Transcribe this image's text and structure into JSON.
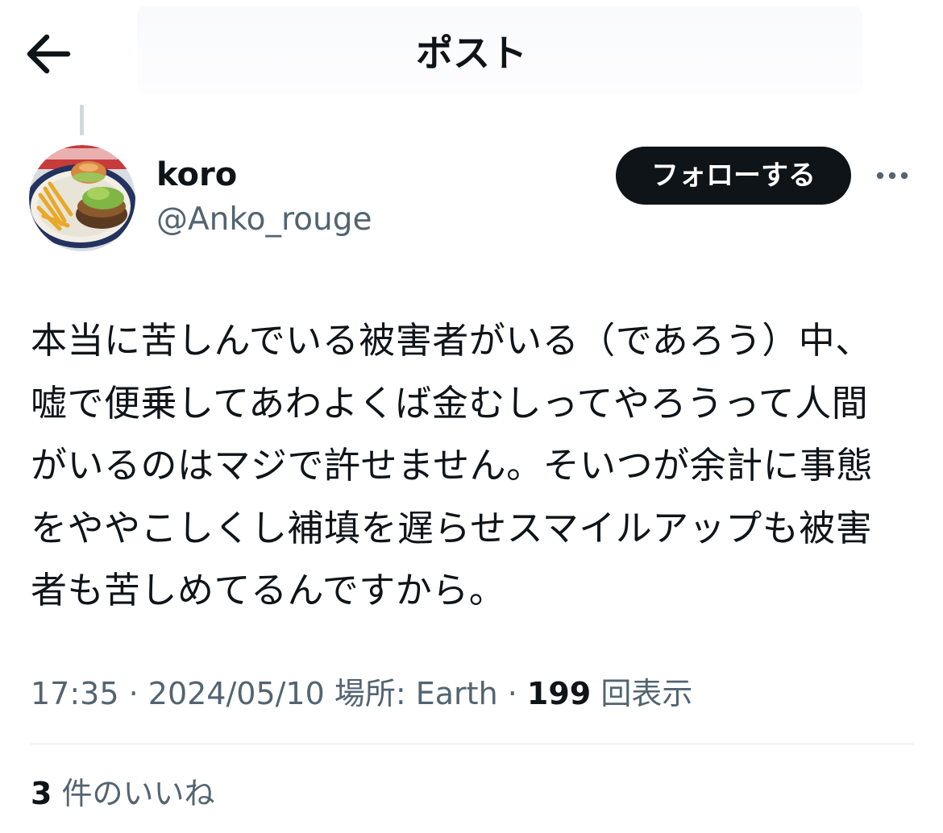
{
  "header": {
    "title": "ポスト",
    "back_icon": "arrow-left-icon"
  },
  "author": {
    "display_name": "koro",
    "handle": "@Anko_rouge",
    "avatar": "avatar-burger-photo"
  },
  "actions": {
    "follow_label": "フォローする",
    "more_icon": "ellipsis-icon"
  },
  "post": {
    "text": "本当に苦しんでいる被害者がいる（であろう）中、\n嘘で便乗してあわよくば金むしってやろうって人間\nがいるのはマジで許せません。そいつが余計に事態\nをややこしくし補填を遅らせスマイルアップも被害\n者も苦しめてるんですから。"
  },
  "meta": {
    "time": "17:35",
    "separator": " · ",
    "date": "2024/05/10",
    "location_label": " 場所: ",
    "location": "Earth",
    "separator2": " · ",
    "views_count": "199",
    "views_label": "回表示"
  },
  "engagement": {
    "likes_count": "3",
    "likes_label": "件のいいね"
  },
  "colors": {
    "text_primary": "#0f1419",
    "text_secondary": "#536471",
    "button_bg": "#0f1419",
    "divider": "#dfe3e6"
  }
}
